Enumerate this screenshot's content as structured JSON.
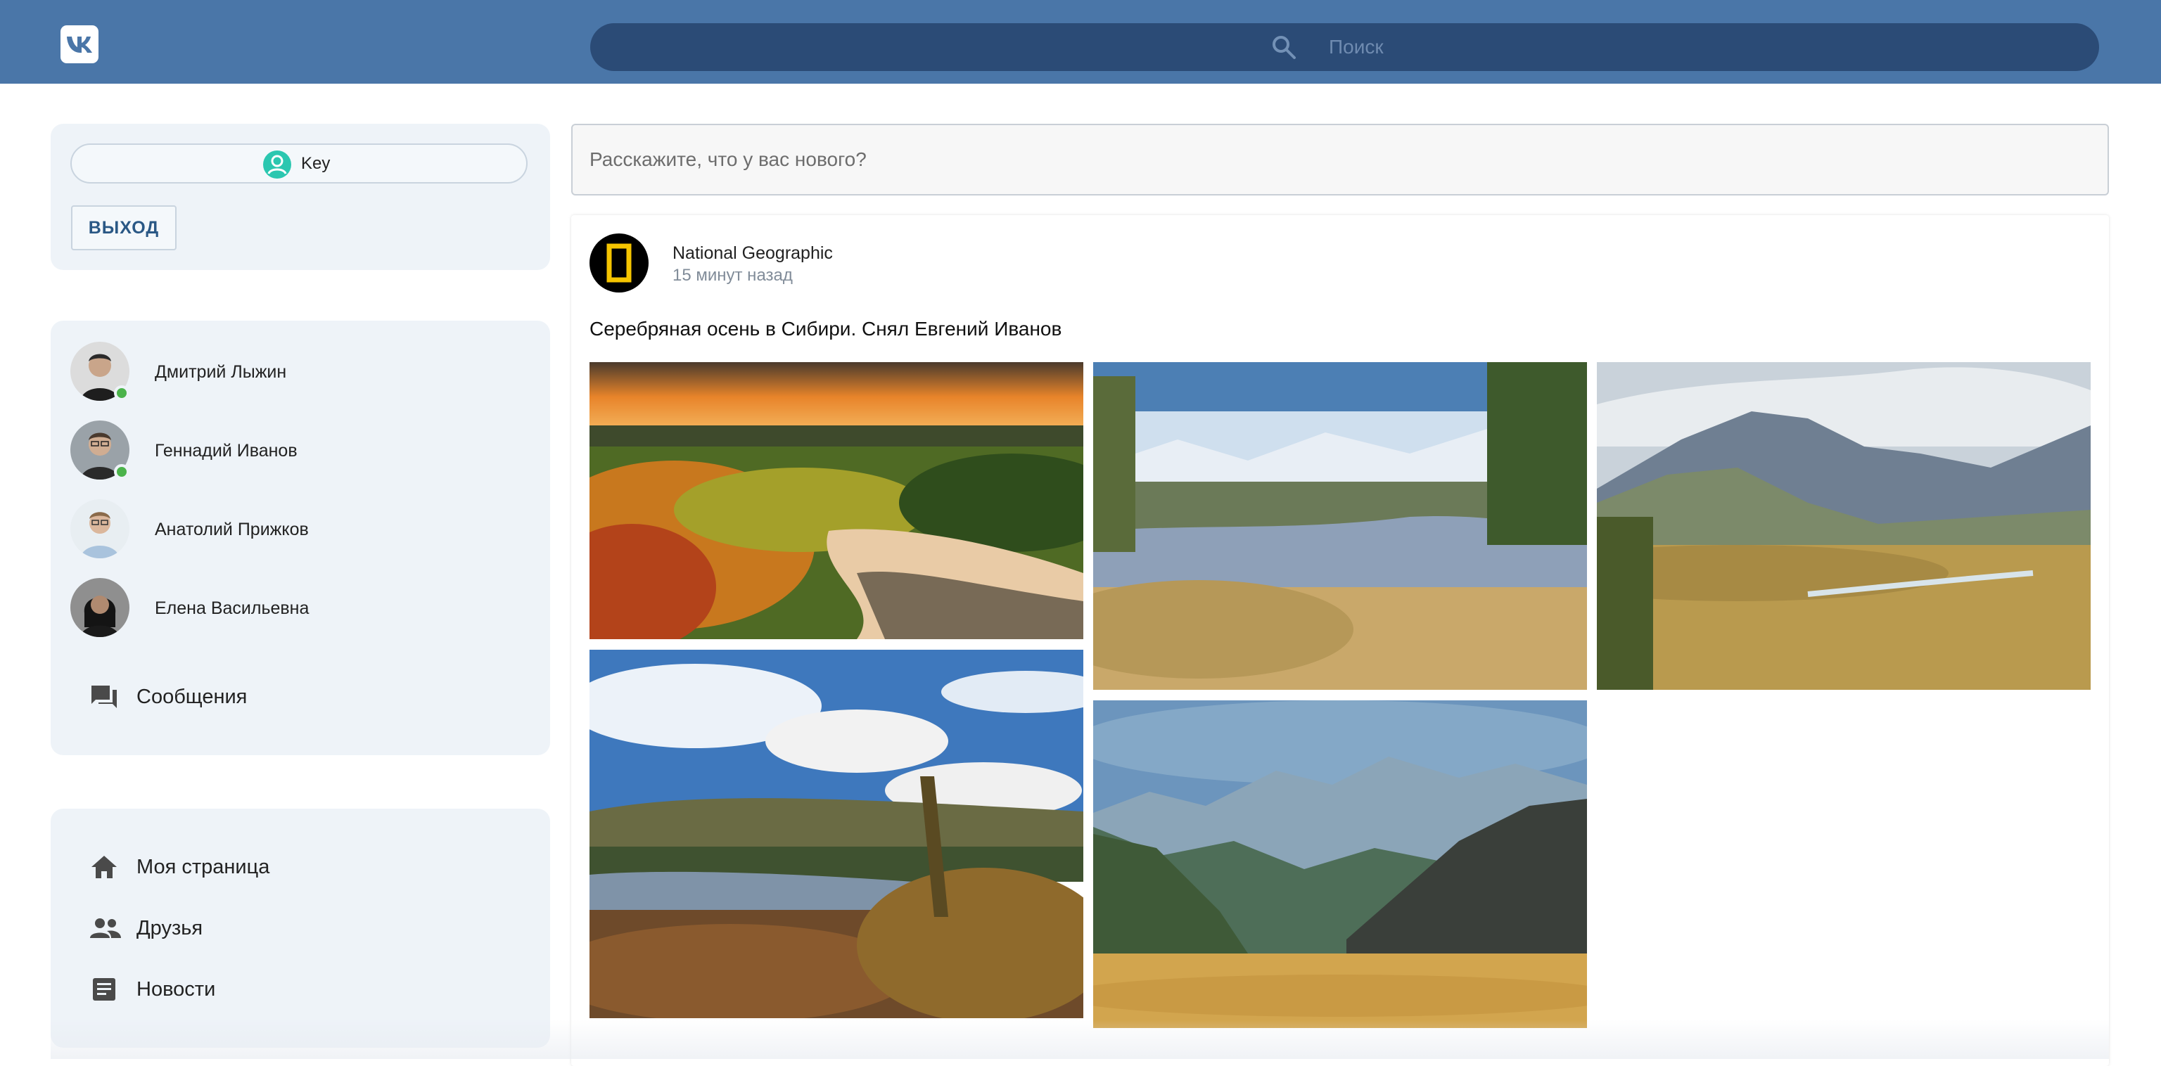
{
  "header": {
    "logo_text": "VK",
    "search_placeholder": "Поиск"
  },
  "account": {
    "username": "Key",
    "logout_label": "ВЫХОД"
  },
  "friends": [
    {
      "name": "Дмитрий Лыжин",
      "online": true
    },
    {
      "name": "Геннадий Иванов",
      "online": true
    },
    {
      "name": "Анатолий Прижков",
      "online": false
    },
    {
      "name": "Елена Васильевна",
      "online": false
    }
  ],
  "messages_label": "Сообщения",
  "nav": {
    "my_page": "Моя страница",
    "friends": "Друзья",
    "news": "Новости"
  },
  "composer_placeholder": "Расскажите, что у вас нового?",
  "post": {
    "author": "National Geographic",
    "time": "15 минут назад",
    "text": "Серебряная осень в Сибири. Снял Евгений Иванов",
    "photo_count": 5
  },
  "colors": {
    "header": "#4a76a8",
    "search": "#2b4b76",
    "card": "#eef3f8",
    "online": "#4bb34b",
    "link": "#2a5885"
  }
}
